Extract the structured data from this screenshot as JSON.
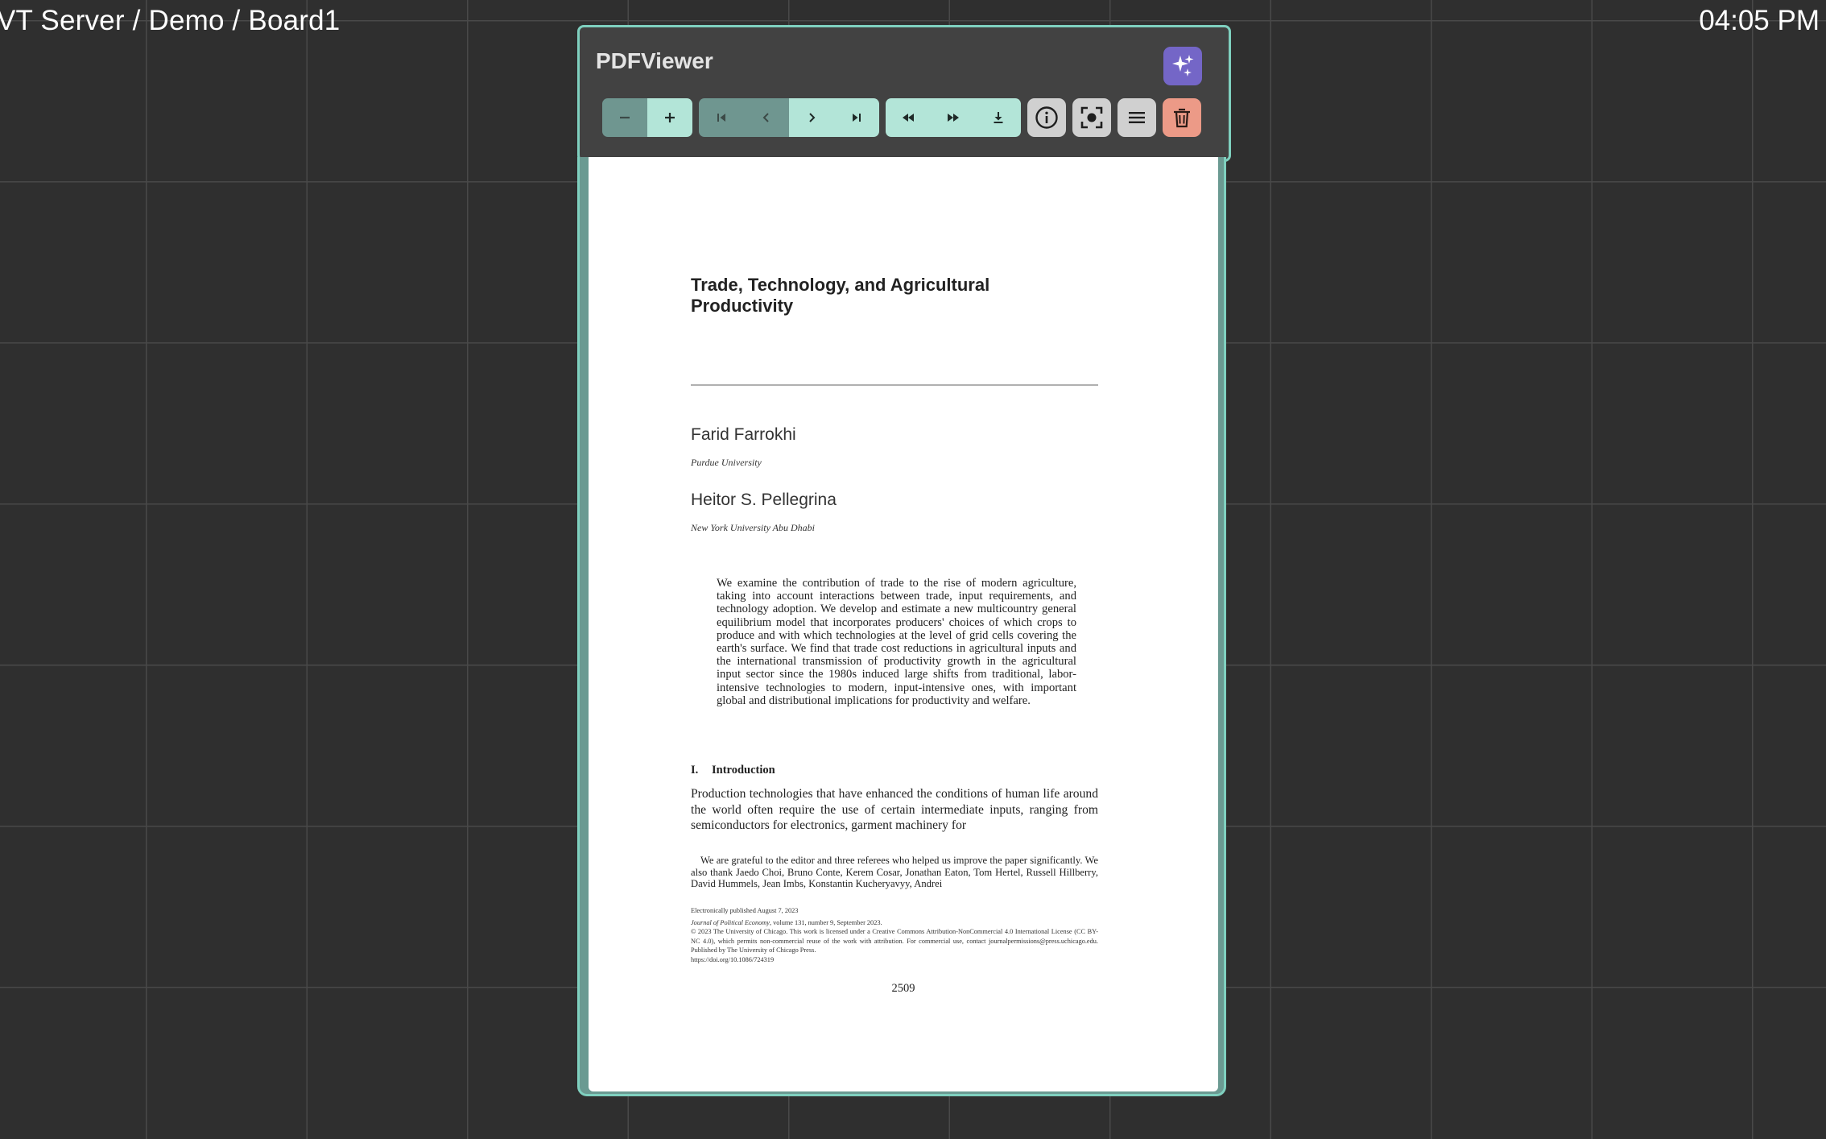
{
  "board_path": "VT Server / Demo / Board1",
  "clock": "04:05 PM",
  "app": {
    "title": "PDFViewer"
  },
  "icons": {
    "ai": "sparkles-icon",
    "zoom_out": "minus-icon",
    "zoom_in": "plus-icon",
    "first_page": "skip-to-first-icon",
    "prev_page": "chevron-left-icon",
    "next_page": "chevron-right-icon",
    "last_page": "skip-to-last-icon",
    "rewind": "rewind-icon",
    "fast_forward": "fast-forward-icon",
    "download": "download-icon",
    "info": "info-icon",
    "screenshot": "capture-icon",
    "menu": "menu-icon",
    "delete": "trash-icon"
  },
  "colors": {
    "accent": "#7fd0bf",
    "ai_button": "#7466c7",
    "delete_button": "#ec9a87",
    "background": "#2f2f2f"
  },
  "document": {
    "title": "Trade, Technology, and Agricultural Productivity",
    "authors": [
      {
        "name": "Farid Farrokhi",
        "affiliation": "Purdue University"
      },
      {
        "name": "Heitor S. Pellegrina",
        "affiliation": "New York University Abu Dhabi"
      }
    ],
    "abstract": "We examine the contribution of trade to the rise of modern agriculture, taking into account interactions between trade, input requirements, and technology adoption. We develop and estimate a new multicountry general equilibrium model that incorporates producers' choices of which crops to produce and with which technologies at the level of grid cells covering the earth's surface. We find that trade cost reductions in agricultural inputs and the international transmission of productivity growth in the agricultural input sector since the 1980s induced large shifts from traditional, labor-intensive technologies to modern, input-intensive ones, with important global and distributional implications for productivity and welfare.",
    "section_number": "I.",
    "section_title": "Introduction",
    "intro_text": "Production technologies that have enhanced the conditions of human life around the world often require the use of certain intermediate inputs, ranging from semiconductors for electronics, garment machinery for",
    "footnote": "We are grateful to the editor and three referees who helped us improve the paper significantly. We also thank Jaedo Choi, Bruno Conte, Kerem Cosar, Jonathan Eaton, Tom Hertel, Russell Hillberry, David Hummels, Jean Imbs, Konstantin Kucheryavyy, Andrei",
    "published": "Electronically published August 7, 2023",
    "journal_name": "Journal of Political Economy",
    "journal_issue": ", volume 131, number 9, September 2023.",
    "license": "© 2023 The University of Chicago. This work is licensed under a Creative Commons Attribution-NonCommercial 4.0 International License (CC BY-NC 4.0), which permits non-commercial reuse of the work with attribution. For commercial use, contact journalpermissions@press.uchicago.edu. Published by The University of Chicago Press.",
    "doi": "https://doi.org/10.1086/724319",
    "page_number": "2509"
  }
}
